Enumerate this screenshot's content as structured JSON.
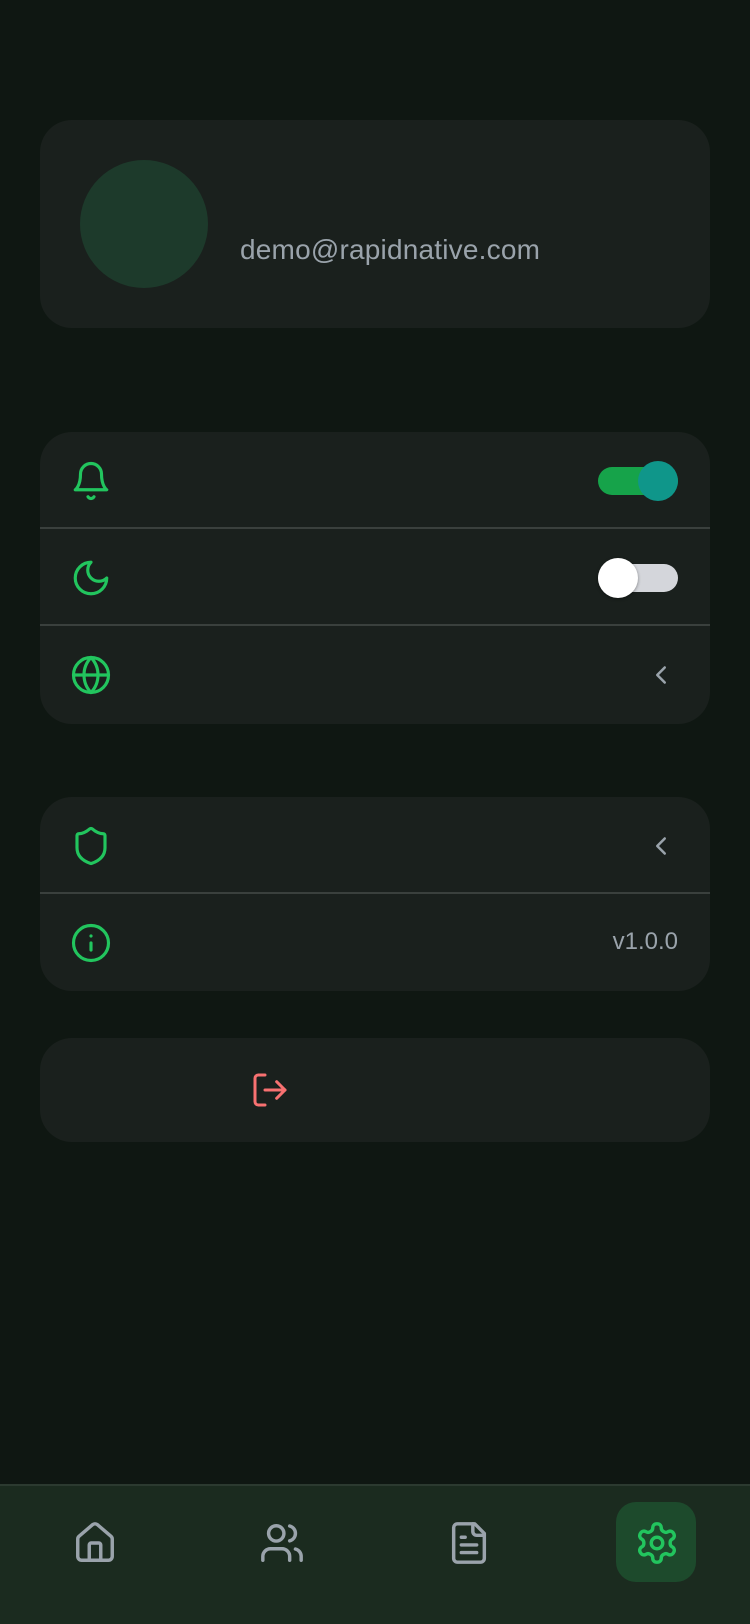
{
  "profile": {
    "email": "demo@rapidnative.com",
    "avatar_color": "#1d3a2b"
  },
  "preferences": {
    "notifications": {
      "icon": "bell-icon",
      "enabled": true
    },
    "dark_mode": {
      "icon": "moon-icon",
      "enabled": false
    },
    "language": {
      "icon": "globe-icon",
      "chevron": "chevron-left-icon"
    }
  },
  "about": {
    "privacy": {
      "icon": "shield-icon",
      "chevron": "chevron-left-icon"
    },
    "version": {
      "icon": "info-icon",
      "value": "v1.0.0"
    }
  },
  "logout": {
    "icon": "logout-icon",
    "color": "#f87171"
  },
  "tabbar": {
    "tabs": [
      {
        "icon": "home-icon",
        "active": false
      },
      {
        "icon": "users-icon",
        "active": false
      },
      {
        "icon": "document-icon",
        "active": false
      },
      {
        "icon": "gear-icon",
        "active": true
      }
    ],
    "active_color": "#22c55e",
    "inactive_color": "#9aa3ab"
  },
  "colors": {
    "accent": "#22c55e",
    "toggle_on_track": "#16a34a",
    "toggle_on_knob": "#0f968a",
    "toggle_off_track": "#d4d6db",
    "background": "#0f1712",
    "card": "#1a201d"
  }
}
